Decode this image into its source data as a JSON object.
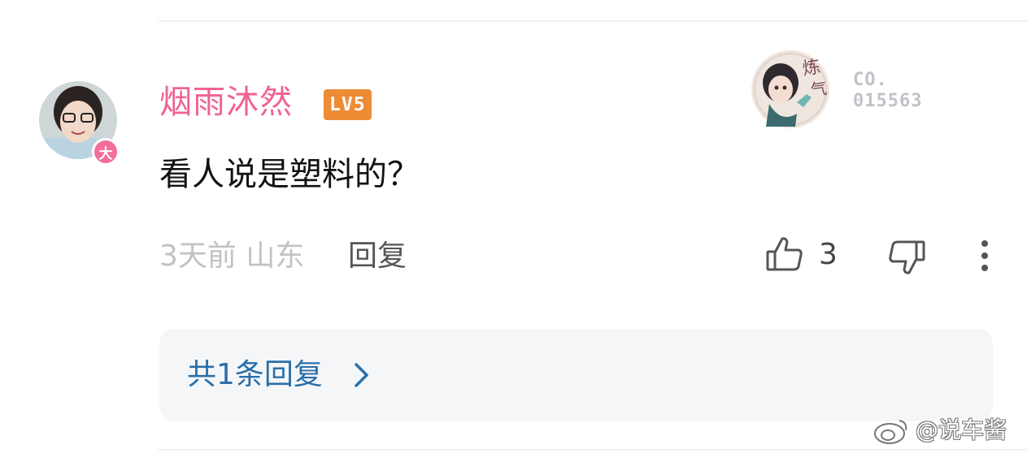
{
  "comment": {
    "username": "烟雨沐然",
    "level": "LV5",
    "avatar_badge": "大",
    "text": "看人说是塑料的？",
    "time_location": "3天前 山东",
    "reply_label": "回复",
    "like_count": "3"
  },
  "medal": {
    "line1": "CO.",
    "line2": "015563"
  },
  "replies": {
    "label": "共1条回复"
  },
  "watermark": {
    "text": "@说车酱"
  },
  "icons": [
    "thumbs-up-icon",
    "thumbs-down-icon",
    "more-icon",
    "chevron-right-icon",
    "weibo-icon"
  ],
  "colors": {
    "username": "#f06292",
    "level_badge": "#ee8b35",
    "reply_link": "#2a6fa8",
    "muted": "#c2c2c2"
  }
}
